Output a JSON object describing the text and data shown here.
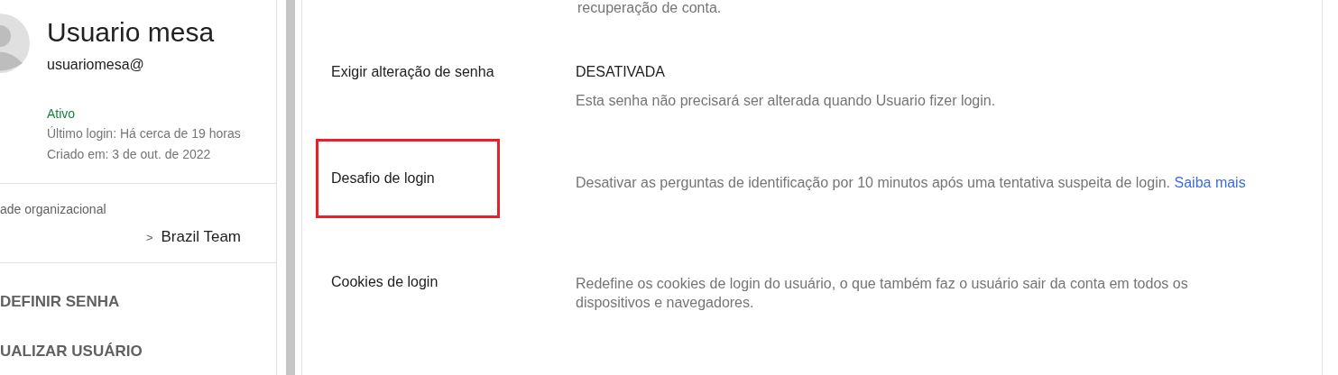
{
  "user": {
    "name": "Usuario mesa",
    "email": "usuariomesa@",
    "status": "Ativo",
    "last_login": "Último login: Há cerca de 19 horas",
    "created": "Criado em: 3 de out. de 2022"
  },
  "org_unit": {
    "label": "ade organizacional",
    "separator": ">",
    "value": "Brazil Team"
  },
  "actions": [
    "DEFINIR SENHA",
    "UALIZAR USUÁRIO"
  ],
  "top_text": "recuperação de conta.",
  "settings": [
    {
      "label": "Exigir alteração de senha",
      "value": "DESATIVADA",
      "description": "Esta senha não precisará ser alterada quando Usuario fizer login.",
      "highlighted": false
    },
    {
      "label": "Desafio de login",
      "description": "Desativar as perguntas de identificação por 10 minutos após uma tentativa suspeita de login.",
      "link": "Saiba mais",
      "highlighted": true
    },
    {
      "label": "Cookies de login",
      "description": "Redefine os cookies de login do usuário, o que também faz o usuário sair da conta em todos os dispositivos e navegadores.",
      "highlighted": false
    }
  ]
}
